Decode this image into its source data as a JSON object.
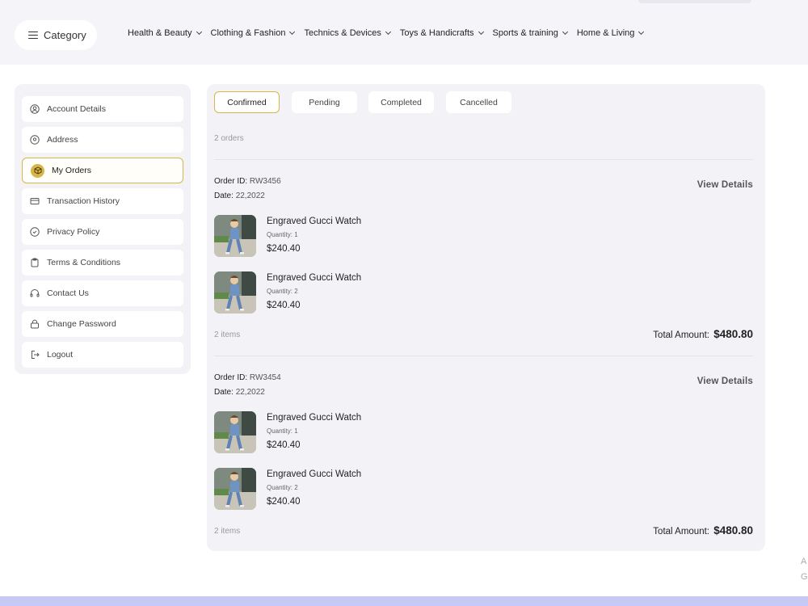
{
  "header": {
    "category_label": "Category",
    "nav": [
      {
        "label": "Health & Beauty"
      },
      {
        "label": "Clothing & Fashion"
      },
      {
        "label": "Technics & Devices"
      },
      {
        "label": "Toys & Handicrafts"
      },
      {
        "label": "Sports & training"
      },
      {
        "label": "Home & Living"
      }
    ]
  },
  "sidebar": {
    "items": [
      {
        "label": "Account Details",
        "icon": "user-circle-icon"
      },
      {
        "label": "Address",
        "icon": "location-pin-icon"
      },
      {
        "label": "My Orders",
        "icon": "box-icon",
        "active": true
      },
      {
        "label": "Transaction History",
        "icon": "card-icon"
      },
      {
        "label": "Privacy Policy",
        "icon": "shield-icon"
      },
      {
        "label": "Terms & Conditions",
        "icon": "clipboard-icon"
      },
      {
        "label": "Contact Us",
        "icon": "headphones-icon"
      },
      {
        "label": "Change Password",
        "icon": "lock-icon"
      },
      {
        "label": "Logout",
        "icon": "logout-icon"
      }
    ]
  },
  "tabs": [
    {
      "label": "Confirmed",
      "active": true
    },
    {
      "label": "Pending"
    },
    {
      "label": "Completed"
    },
    {
      "label": "Cancelled"
    }
  ],
  "orders_count": "2 orders",
  "orders": [
    {
      "id_label": "Order ID:",
      "id": "RW3456",
      "date_label": "Date:",
      "date": "22,2022",
      "view_details": "View Details",
      "products": [
        {
          "name": "Engraved Gucci Watch",
          "qty": "Quantity: 1",
          "price": "$240.40"
        },
        {
          "name": "Engraved Gucci Watch",
          "qty": "Quantity: 2",
          "price": "$240.40"
        }
      ],
      "items_count": "2 items",
      "total_label": "Total Amount:",
      "total": "$480.80"
    },
    {
      "id_label": "Order ID:",
      "id": "RW3454",
      "date_label": "Date:",
      "date": "22,2022",
      "view_details": "View Details",
      "products": [
        {
          "name": "Engraved Gucci Watch",
          "qty": "Quantity: 1",
          "price": "$240.40"
        },
        {
          "name": "Engraved Gucci Watch",
          "qty": "Quantity: 2",
          "price": "$240.40"
        }
      ],
      "items_count": "2 items",
      "total_label": "Total Amount:",
      "total": "$480.80"
    }
  ],
  "edge_text": [
    "A",
    "G"
  ],
  "colors": {
    "accent": "#d4b74a",
    "panel": "#f3f3f7",
    "footer": "#c7c9f5"
  }
}
